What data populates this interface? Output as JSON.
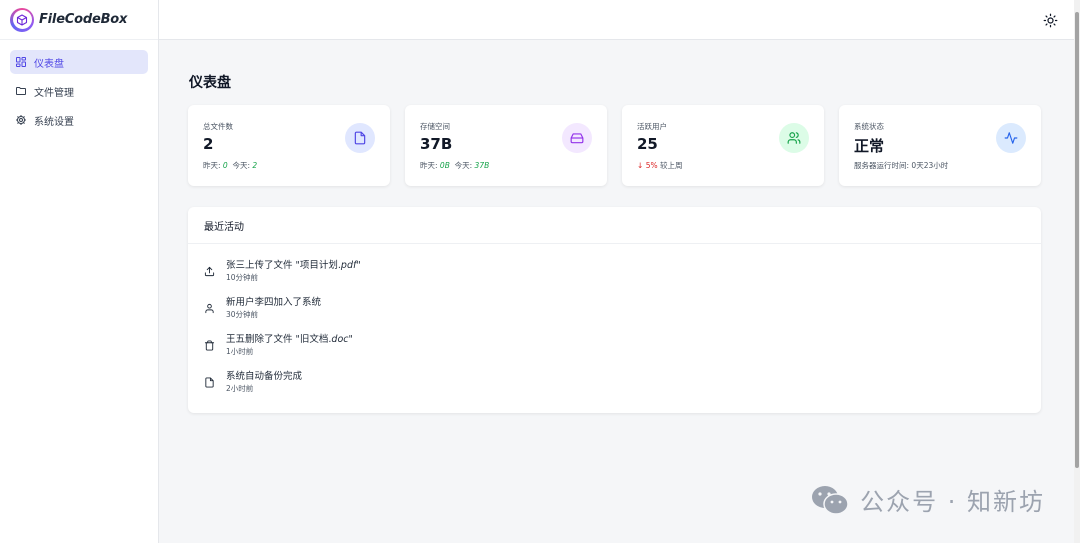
{
  "app": {
    "name": "FileCodeBox"
  },
  "sidebar": {
    "items": [
      {
        "label": "仪表盘",
        "icon": "dashboard-grid-icon",
        "active": true
      },
      {
        "label": "文件管理",
        "icon": "folder-icon",
        "active": false
      },
      {
        "label": "系统设置",
        "icon": "gear-icon",
        "active": false
      }
    ]
  },
  "topbar": {
    "theme_icon": "sun-icon"
  },
  "page": {
    "title": "仪表盘"
  },
  "stats": [
    {
      "label": "总文件数",
      "value": "2",
      "sub_prefix1": "昨天:",
      "sub_val1": "0",
      "sub_prefix2": "今天:",
      "sub_val2": "2",
      "icon": "file-icon",
      "icon_color": "#4f46e5",
      "icon_bg": "#e0e7ff"
    },
    {
      "label": "存储空间",
      "value": "37B",
      "sub_prefix1": "昨天:",
      "sub_val1": "0B",
      "sub_prefix2": "今天:",
      "sub_val2": "37B",
      "icon": "hard-drive-icon",
      "icon_color": "#9333ea",
      "icon_bg": "#f3e8ff"
    },
    {
      "label": "活跃用户",
      "value": "25",
      "trend_arrow": "↓",
      "trend_value": "5%",
      "trend_text": "较上周",
      "icon": "users-icon",
      "icon_color": "#16a34a",
      "icon_bg": "#dcfce7"
    },
    {
      "label": "系统状态",
      "value": "正常",
      "uptime_label": "服务器运行时间:",
      "uptime_value": "0天23小时",
      "icon": "activity-icon",
      "icon_color": "#2563eb",
      "icon_bg": "#dbeafe"
    }
  ],
  "activity": {
    "title": "最近活动",
    "items": [
      {
        "text_prefix": "张三上传了文件 \"项目计划.",
        "text_em": "pdf",
        "text_suffix": "\"",
        "time": "10分钟前",
        "icon": "upload-icon"
      },
      {
        "text_prefix": "新用户李四加入了系统",
        "text_em": "",
        "text_suffix": "",
        "time": "30分钟前",
        "icon": "user-icon"
      },
      {
        "text_prefix": "王五删除了文件 \"旧文档.",
        "text_em": "doc",
        "text_suffix": "\"",
        "time": "1小时前",
        "icon": "trash-icon"
      },
      {
        "text_prefix": "系统自动备份完成",
        "text_em": "",
        "text_suffix": "",
        "time": "2小时前",
        "icon": "file-icon"
      }
    ]
  },
  "watermark": {
    "text": "公众号 · 知新坊",
    "icon": "wechat-icon"
  }
}
